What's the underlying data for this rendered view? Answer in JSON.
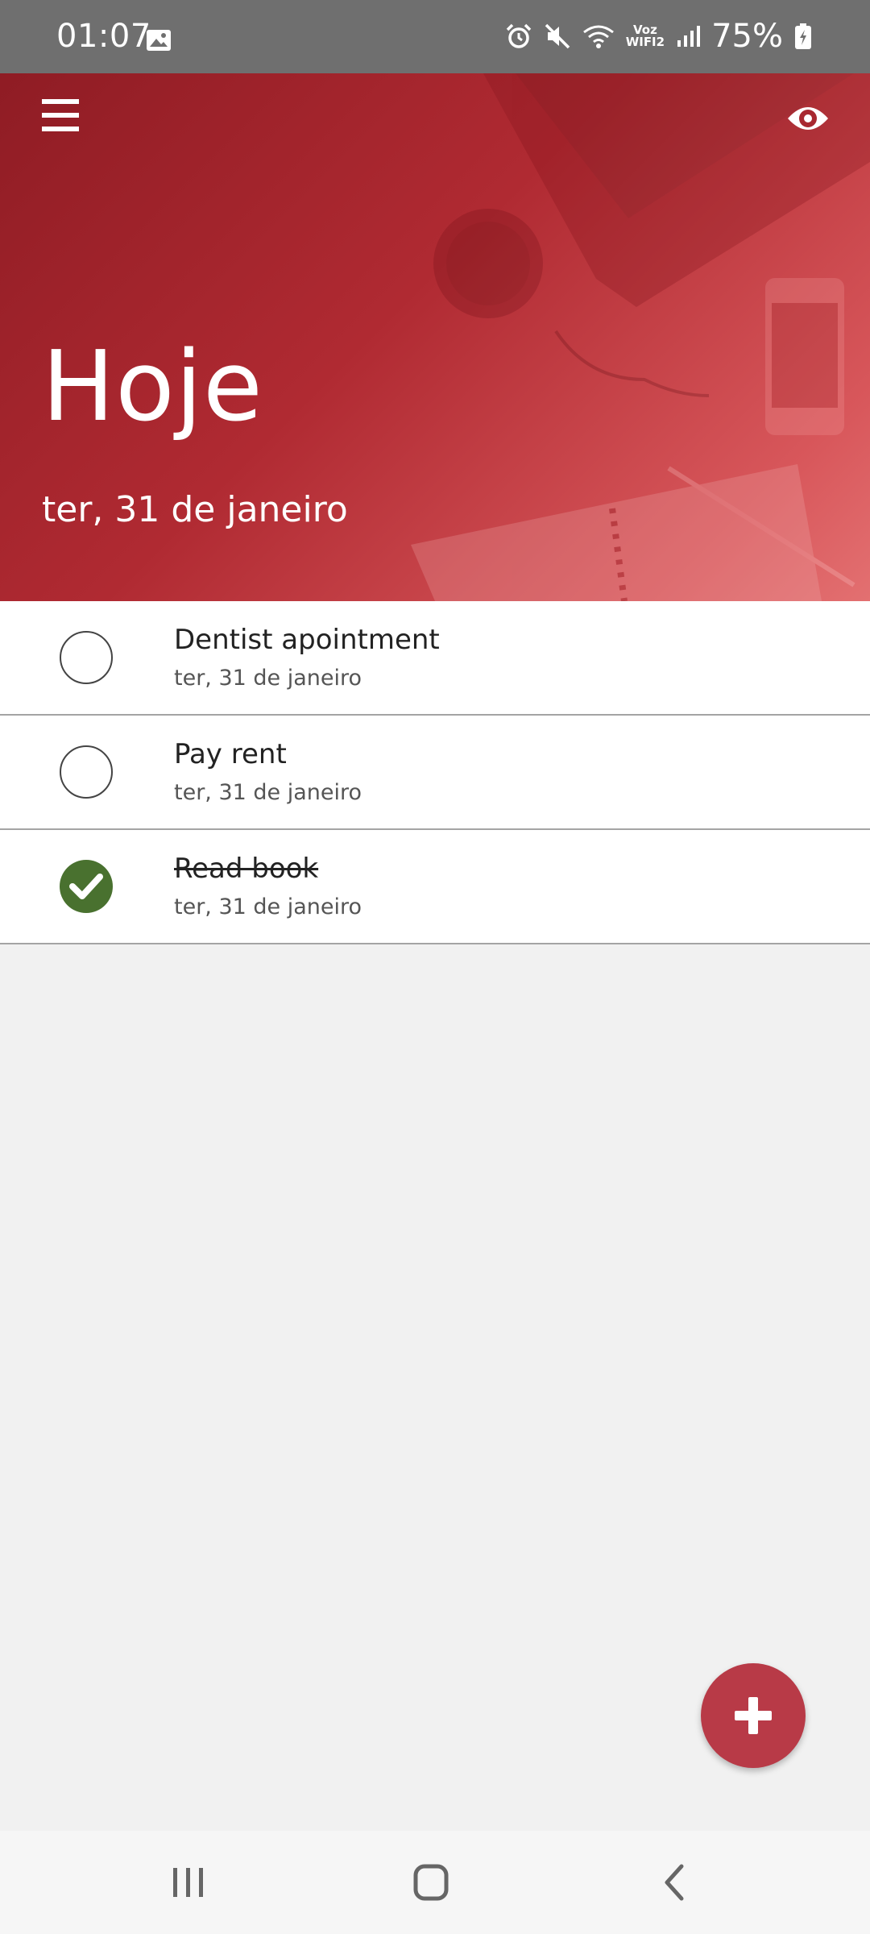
{
  "status_bar": {
    "time": "01:07",
    "wifi_label_top": "Voz",
    "wifi_label_bottom": "WIFI2",
    "battery": "75%",
    "icons": [
      "gallery-icon",
      "alarm-icon",
      "mute-icon",
      "wifi-icon",
      "signal-icon",
      "battery-icon"
    ]
  },
  "header": {
    "title": "Hoje",
    "date": "ter, 31 de janeiro",
    "accent_color": "#b02a32"
  },
  "tasks": [
    {
      "title": "Dentist apointment",
      "date": "ter, 31 de janeiro",
      "completed": false
    },
    {
      "title": "Pay rent",
      "date": "ter, 31 de janeiro",
      "completed": false
    },
    {
      "title": "Read book",
      "date": "ter, 31 de janeiro",
      "completed": true
    }
  ],
  "colors": {
    "completed_check": "#49712f",
    "fab": "#b83a47"
  },
  "fab": {
    "icon": "plus-icon"
  },
  "nav": {
    "icons": [
      "recents-icon",
      "home-icon",
      "back-icon"
    ]
  }
}
